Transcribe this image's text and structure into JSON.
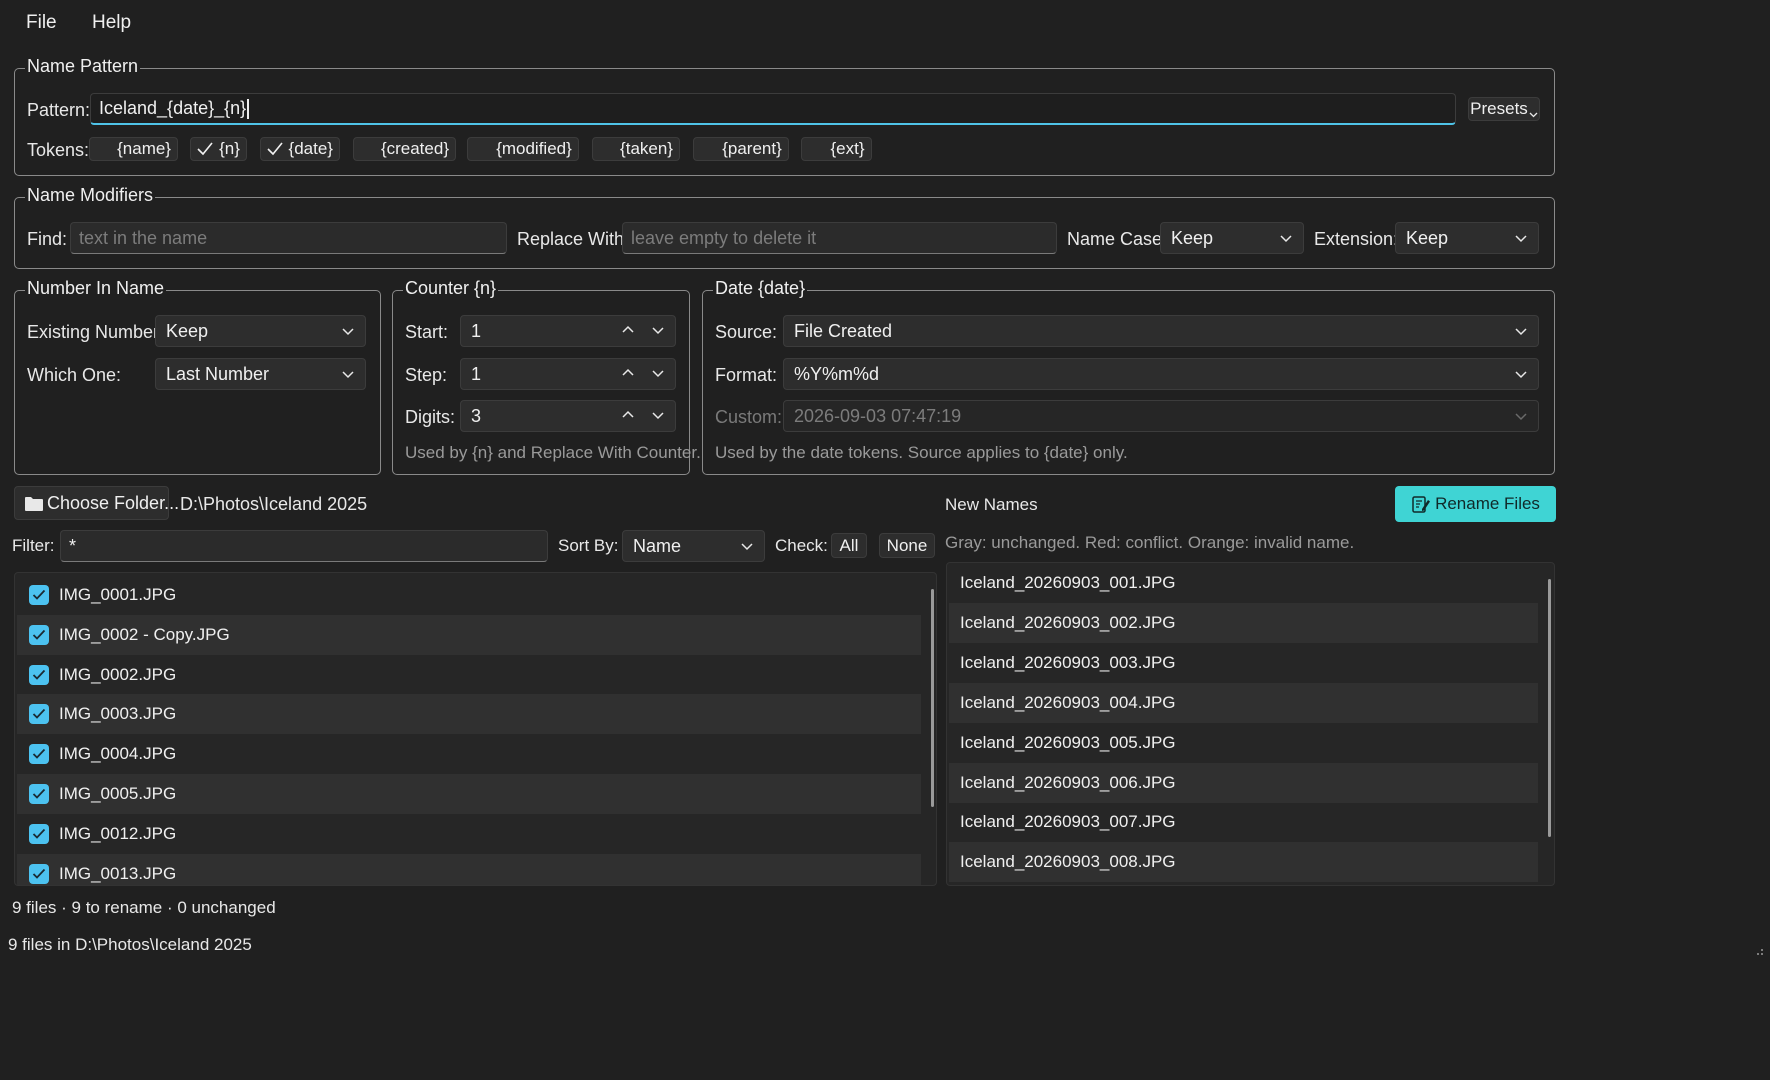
{
  "menu": {
    "file": "File",
    "help": "Help"
  },
  "name_pattern": {
    "title": "Name Pattern",
    "pattern_label": "Pattern:",
    "pattern_value": "Iceland_{date}_{n}",
    "presets_label": "Presets",
    "tokens_label": "Tokens:",
    "tokens": [
      {
        "label": "{name}",
        "checked": false
      },
      {
        "label": "{n}",
        "checked": true
      },
      {
        "label": "{date}",
        "checked": true
      },
      {
        "label": "{created}",
        "checked": false
      },
      {
        "label": "{modified}",
        "checked": false
      },
      {
        "label": "{taken}",
        "checked": false
      },
      {
        "label": "{parent}",
        "checked": false
      },
      {
        "label": "{ext}",
        "checked": false
      }
    ]
  },
  "modifiers": {
    "title": "Name Modifiers",
    "find_label": "Find:",
    "find_placeholder": "text in the name",
    "replace_label": "Replace With:",
    "replace_placeholder": "leave empty to delete it",
    "case_label": "Name Case:",
    "case_value": "Keep",
    "extension_label": "Extension:",
    "extension_value": "Keep"
  },
  "number_in_name": {
    "title": "Number In Name",
    "existing_label": "Existing Number:",
    "existing_value": "Keep",
    "which_label": "Which One:",
    "which_value": "Last Number"
  },
  "counter": {
    "title": "Counter  {n}",
    "start_label": "Start:",
    "start_value": "1",
    "step_label": "Step:",
    "step_value": "1",
    "digits_label": "Digits:",
    "digits_value": "3",
    "hint": "Used by {n} and Replace With Counter."
  },
  "date": {
    "title": "Date  {date}",
    "source_label": "Source:",
    "source_value": "File Created",
    "format_label": "Format:",
    "format_value": "%Y%m%d",
    "custom_label": "Custom:",
    "custom_value": "2026-09-03 07:47:19",
    "hint": "Used by the date tokens. Source applies to {date} only."
  },
  "folder": {
    "choose_label": "Choose Folder...",
    "path": "D:\\Photos\\Iceland 2025"
  },
  "filter": {
    "label": "Filter:",
    "value": "*",
    "sort_label": "Sort By:",
    "sort_value": "Name",
    "check_label": "Check:",
    "all_label": "All",
    "none_label": "None"
  },
  "files": [
    "IMG_0001.JPG",
    "IMG_0002 - Copy.JPG",
    "IMG_0002.JPG",
    "IMG_0003.JPG",
    "IMG_0004.JPG",
    "IMG_0005.JPG",
    "IMG_0012.JPG",
    "IMG_0013.JPG"
  ],
  "new_names": {
    "title": "New Names",
    "rename_label": "Rename Files",
    "legend": "Gray: unchanged.  Red: conflict.  Orange: invalid name.",
    "items": [
      "Iceland_20260903_001.JPG",
      "Iceland_20260903_002.JPG",
      "Iceland_20260903_003.JPG",
      "Iceland_20260903_004.JPG",
      "Iceland_20260903_005.JPG",
      "Iceland_20260903_006.JPG",
      "Iceland_20260903_007.JPG",
      "Iceland_20260903_008.JPG"
    ]
  },
  "summary": "9 files  ·  9 to rename  ·  0 unchanged",
  "statusbar": "9 files in D:\\Photos\\Iceland 2025",
  "colors": {
    "accent": "#3fd4d4",
    "checkbox": "#4cc2f0",
    "focus": "#4fc3e8",
    "background": "#202020"
  }
}
